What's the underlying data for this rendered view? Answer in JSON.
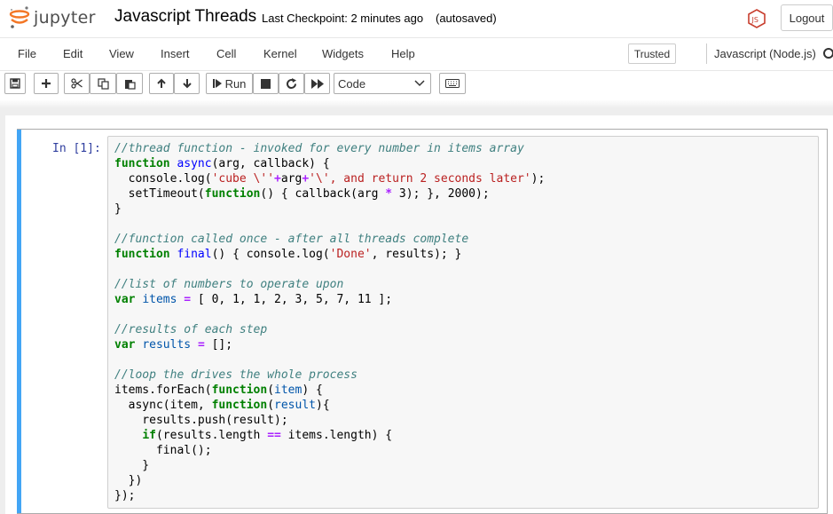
{
  "header": {
    "logo_text": "jupyter",
    "notebook_name": "Javascript Threads",
    "checkpoint": "Last Checkpoint: 2 minutes ago",
    "autosave": "(autosaved)",
    "logout_label": "Logout"
  },
  "menu": {
    "items": [
      "File",
      "Edit",
      "View",
      "Insert",
      "Cell",
      "Kernel",
      "Widgets",
      "Help"
    ],
    "trusted_label": "Trusted",
    "kernel_name": "Javascript (Node.js)"
  },
  "toolbar": {
    "run_label": "Run",
    "cell_type": "Code",
    "buttons": [
      "save-icon",
      "plus-icon",
      "cut-icon",
      "copy-icon",
      "paste-icon",
      "arrow-up-icon",
      "arrow-down-icon",
      "run-icon",
      "stop-icon",
      "restart-icon",
      "fast-forward-icon",
      "keyboard-icon"
    ]
  },
  "cell": {
    "prompt": "In [1]:",
    "lines": [
      "//thread function - invoked for every number in items array",
      "function async(arg, callback) {",
      "  console.log('cube \\''+arg+'\\', and return 2 seconds later');",
      "  setTimeout(function() { callback(arg * 3); }, 2000);",
      "}",
      "",
      "//function called once - after all threads complete",
      "function final() { console.log('Done', results); }",
      "",
      "//list of numbers to operate upon",
      "var items = [ 0, 1, 1, 2, 3, 5, 7, 11 ];",
      "",
      "//results of each step",
      "var results = [];",
      "",
      "//loop the drives the whole process",
      "items.forEach(function(item) {",
      "  async(item, function(result){",
      "    results.push(result);",
      "    if(results.length == items.length) {",
      "      final();",
      "    }",
      "  })",
      "});"
    ]
  },
  "colors": {
    "cell_bar": "#42a5f5",
    "prompt": "#303f9f",
    "comment": "#408080",
    "keyword": "#008000",
    "string": "#ba2121"
  }
}
